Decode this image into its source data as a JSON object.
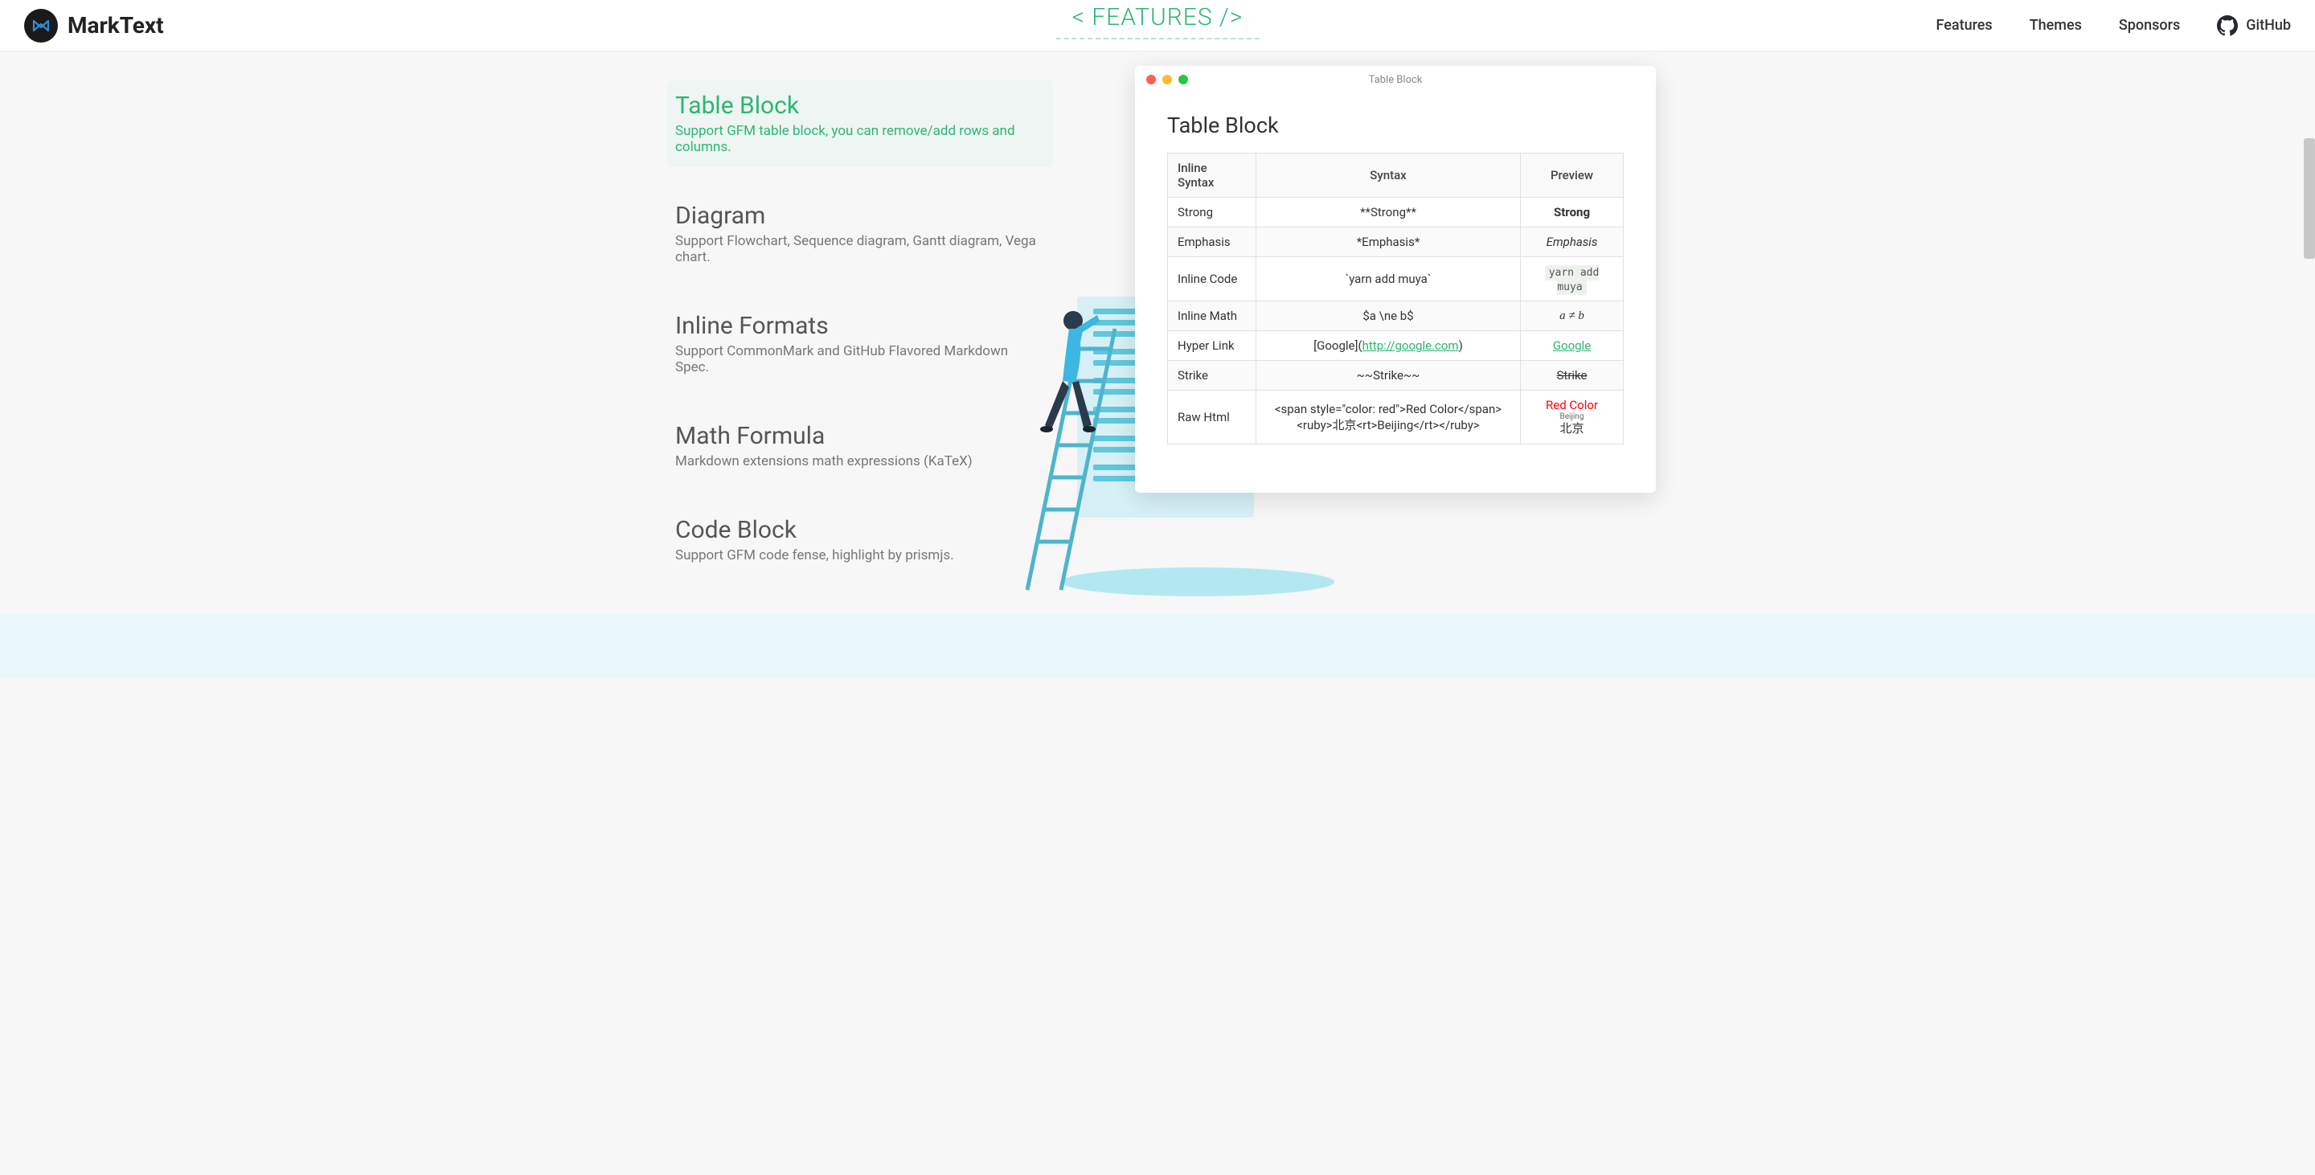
{
  "brand": {
    "name": "MarkText"
  },
  "section_title": "< FEATURES />",
  "nav": {
    "features": "Features",
    "themes": "Themes",
    "sponsors": "Sponsors",
    "github": "GitHub"
  },
  "features": [
    {
      "title": "Table Block",
      "desc": "Support GFM table block, you can remove/add rows and columns."
    },
    {
      "title": "Diagram",
      "desc": "Support Flowchart, Sequence diagram, Gantt diagram, Vega chart."
    },
    {
      "title": "Inline Formats",
      "desc": "Support CommonMark and GitHub Flavored Markdown Spec."
    },
    {
      "title": "Math Formula",
      "desc": "Markdown extensions math expressions (KaTeX)"
    },
    {
      "title": "Code Block",
      "desc": "Support GFM code fense, highlight by prismjs."
    }
  ],
  "preview": {
    "window_title": "Table Block",
    "heading": "Table Block",
    "headers": {
      "c1": "Inline Syntax",
      "c2": "Syntax",
      "c3": "Preview"
    },
    "rows": {
      "strong": {
        "name": "Strong",
        "syntax": "**Strong**",
        "preview": "Strong"
      },
      "emphasis": {
        "name": "Emphasis",
        "syntax": "*Emphasis*",
        "preview": "Emphasis"
      },
      "inline_code": {
        "name": "Inline Code",
        "syntax": "`yarn add muya`",
        "preview": "yarn add muya"
      },
      "inline_math": {
        "name": "Inline Math",
        "syntax": "$a \\ne b$",
        "preview": "a ≠ b"
      },
      "hyperlink": {
        "name": "Hyper Link",
        "syntax_pre": "[Google](",
        "syntax_link": "http://google.com",
        "syntax_post": ")",
        "preview": "Google"
      },
      "strike": {
        "name": "Strike",
        "syntax": "~~Strike~~",
        "preview": "Strike"
      },
      "rawhtml": {
        "name": "Raw Html",
        "syntax_line1": "<span style=\"color: red\">Red Color</span>",
        "syntax_line2": "<ruby>北京<rt>Beijing</rt></ruby>",
        "preview_red": "Red Color",
        "preview_ruby_base": "北京",
        "preview_ruby_rt": "Beijing"
      }
    }
  }
}
